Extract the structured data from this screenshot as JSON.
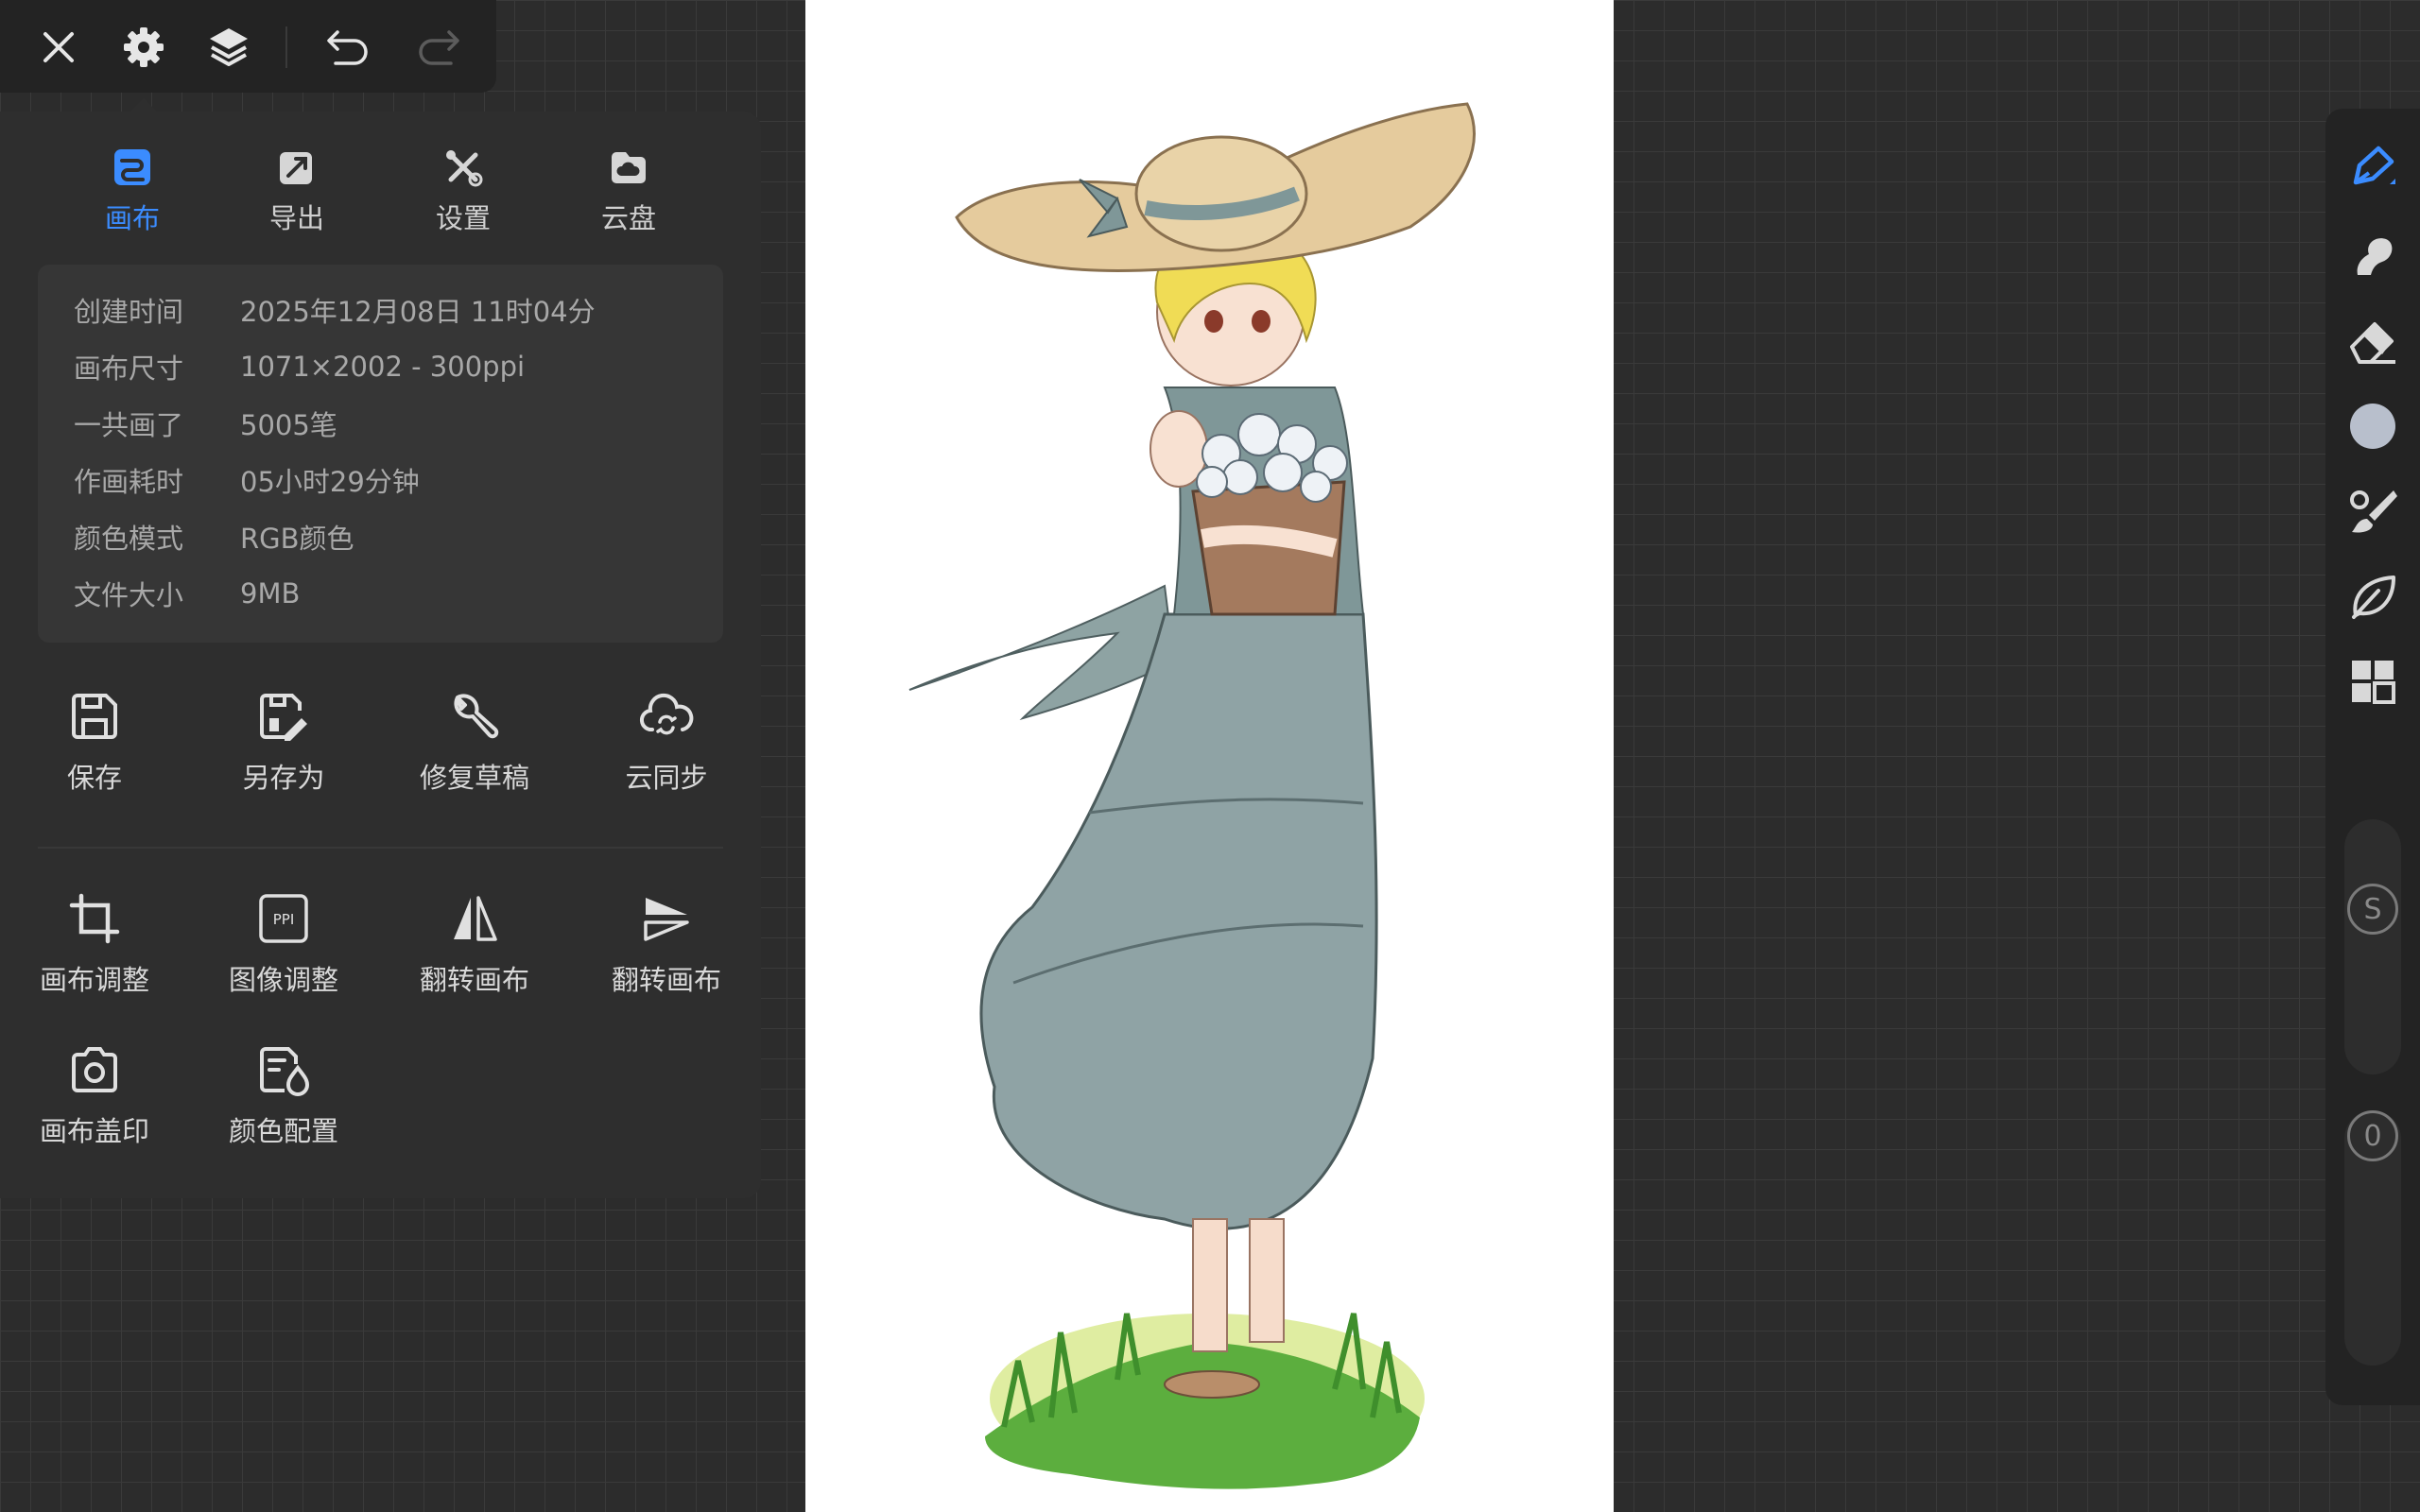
{
  "toolbar": {
    "icons": [
      "close-icon",
      "gear-icon",
      "layers-icon",
      "undo-icon",
      "redo-icon"
    ]
  },
  "tabs": [
    {
      "label": "画布",
      "icon": "canvas-icon",
      "active": true
    },
    {
      "label": "导出",
      "icon": "export-icon",
      "active": false
    },
    {
      "label": "设置",
      "icon": "tools-icon",
      "active": false
    },
    {
      "label": "云盘",
      "icon": "cloud-drive-icon",
      "active": false
    }
  ],
  "info": [
    {
      "key": "创建时间",
      "value": "2025年12月08日 11时04分"
    },
    {
      "key": "画布尺寸",
      "value": "1071×2002 - 300ppi"
    },
    {
      "key": "一共画了",
      "value": "5005笔"
    },
    {
      "key": "作画耗时",
      "value": "05小时29分钟"
    },
    {
      "key": "颜色模式",
      "value": "RGB颜色"
    },
    {
      "key": "文件大小",
      "value": "9MB"
    }
  ],
  "actions_row1": [
    {
      "label": "保存",
      "icon": "save-icon"
    },
    {
      "label": "另存为",
      "icon": "save-as-icon"
    },
    {
      "label": "修复草稿",
      "icon": "wrench-icon"
    },
    {
      "label": "云同步",
      "icon": "cloud-sync-icon"
    }
  ],
  "actions_row2": [
    {
      "label": "画布调整",
      "icon": "crop-icon"
    },
    {
      "label": "图像调整",
      "icon": "ppi-icon",
      "badge": "PPI"
    },
    {
      "label": "翻转画布",
      "icon": "flip-horizontal-icon"
    },
    {
      "label": "翻转画布",
      "icon": "flip-vertical-icon"
    }
  ],
  "actions_row3": [
    {
      "label": "画布盖印",
      "icon": "camera-icon"
    },
    {
      "label": "颜色配置",
      "icon": "color-config-icon"
    }
  ],
  "right_tools": [
    "brush-icon",
    "smudge-icon",
    "eraser-icon",
    "color-swatch-icon",
    "brush-settings-icon",
    "leaf-icon",
    "grid-icon"
  ],
  "sliders": {
    "size_label": "S",
    "opacity_label": "0"
  },
  "colors": {
    "accent": "#3b8cff",
    "panel": "#2e2e2e",
    "toolbar": "#232323",
    "swatch": "#b8bfcc"
  }
}
